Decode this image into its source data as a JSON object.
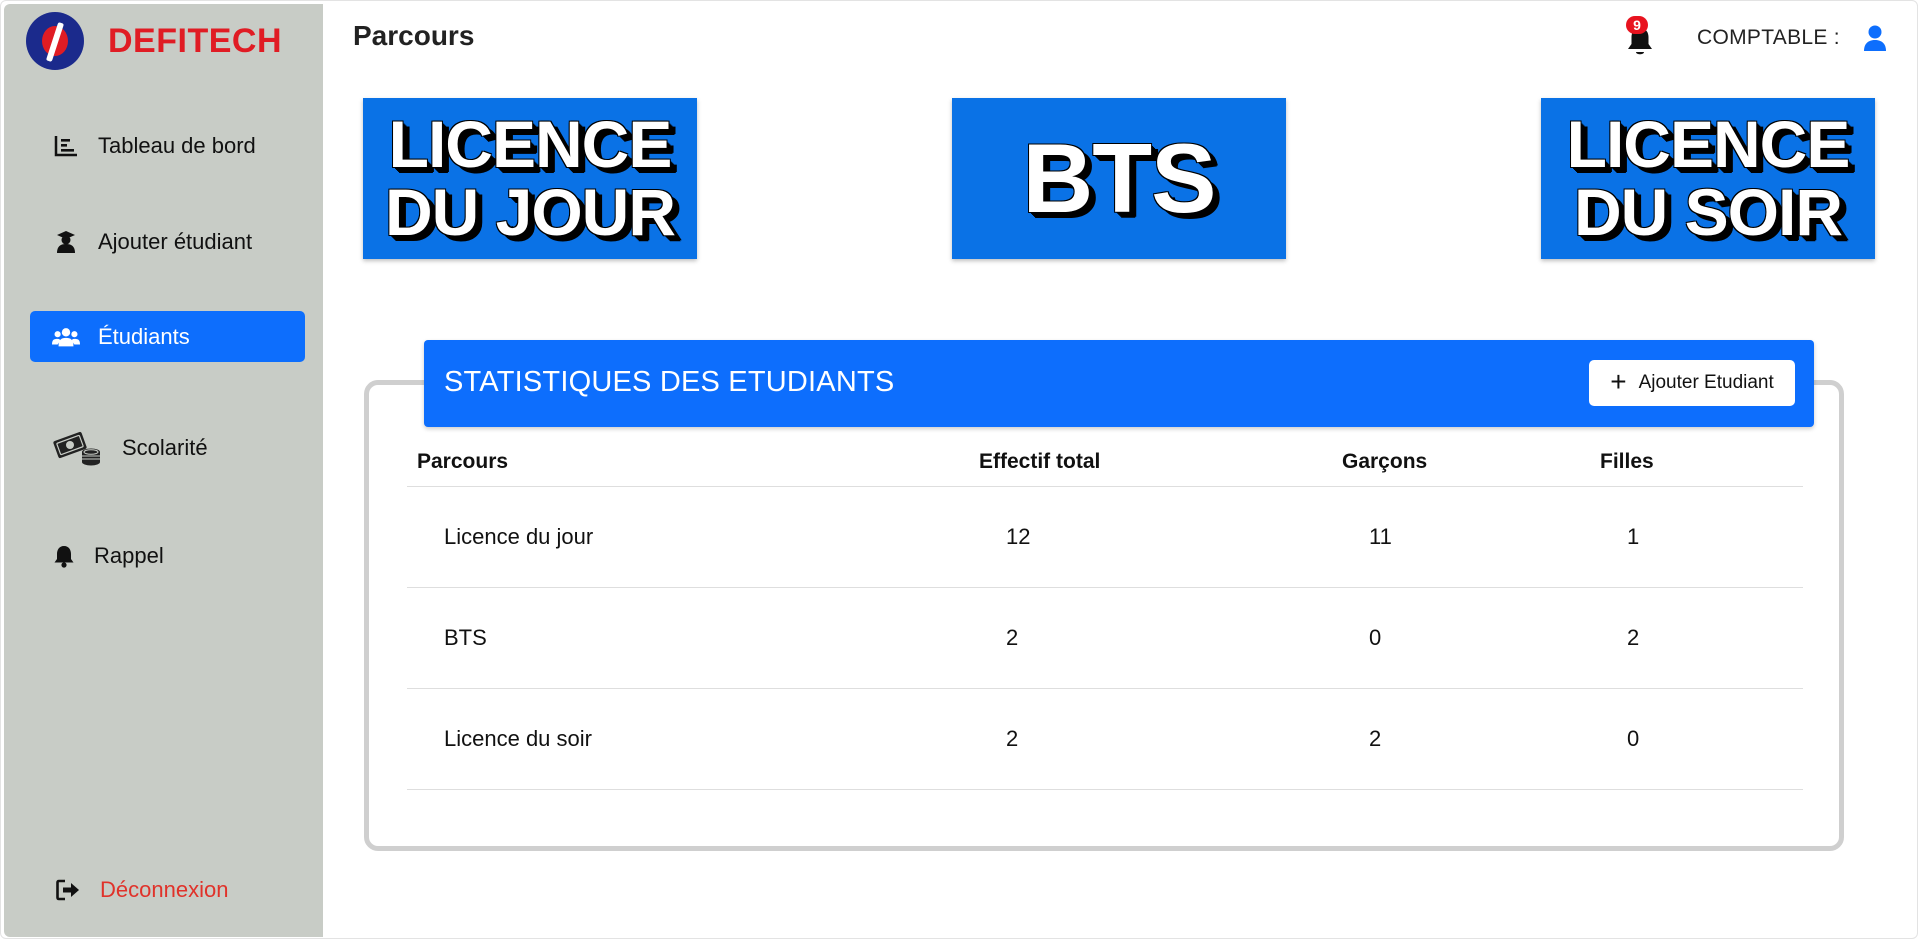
{
  "brand": {
    "name": "DEFITECH"
  },
  "sidebar": {
    "items": [
      {
        "label": "Tableau de bord",
        "icon": "chart-icon"
      },
      {
        "label": "Ajouter étudiant",
        "icon": "graduate-icon"
      },
      {
        "label": "Étudiants",
        "icon": "users-icon",
        "active": true
      },
      {
        "label": "Scolarité",
        "icon": "money-icon"
      },
      {
        "label": "Rappel",
        "icon": "bell-icon"
      }
    ],
    "logout": {
      "label": "Déconnexion",
      "icon": "logout-icon"
    }
  },
  "header": {
    "title": "Parcours",
    "notifications_count": "9",
    "role": "COMPTABLE :"
  },
  "tiles": [
    {
      "line1": "LICENCE",
      "line2": "DU JOUR"
    },
    {
      "line1": "BTS"
    },
    {
      "line1": "LICENCE",
      "line2": "DU SOIR"
    }
  ],
  "stats": {
    "title": "STATISTIQUES DES ETUDIANTS",
    "add_button": "Ajouter Etudiant",
    "columns": [
      "Parcours",
      "Effectif total",
      "Garçons",
      "Filles"
    ],
    "rows": [
      {
        "parcours": "Licence du jour",
        "total": "12",
        "garcons": "11",
        "filles": "1"
      },
      {
        "parcours": "BTS",
        "total": "2",
        "garcons": "0",
        "filles": "2"
      },
      {
        "parcours": "Licence du soir",
        "total": "2",
        "garcons": "2",
        "filles": "0"
      }
    ]
  },
  "colors": {
    "primary": "#0d6efd",
    "tile": "#0a72e6",
    "sidebar": "#c8ccc6",
    "brand": "#e01c24",
    "logout": "#e0322a"
  }
}
